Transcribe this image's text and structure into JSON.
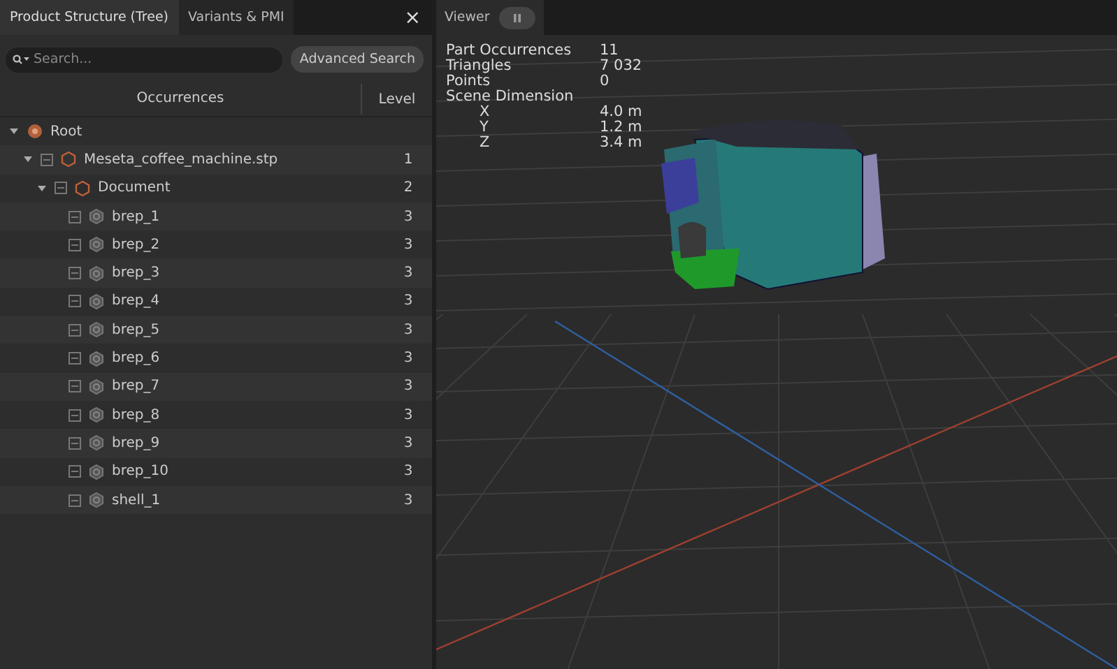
{
  "left_panel": {
    "tabs": [
      {
        "label": "Product Structure (Tree)",
        "selected": true
      },
      {
        "label": "Variants & PMI",
        "selected": false
      }
    ],
    "close": "×",
    "search": {
      "placeholder": "Search..."
    },
    "advanced_search": "Advanced Search",
    "columns": [
      "Occurrences",
      "Level"
    ],
    "tree": [
      {
        "name": "Root",
        "kind": "root",
        "expanded": true,
        "children": [
          {
            "name": "Meseta_coffee_machine.stp",
            "level": "1",
            "kind": "assembly",
            "checked": true,
            "expanded": true,
            "children": [
              {
                "name": "Document",
                "level": "2",
                "kind": "assembly",
                "checked": true,
                "expanded": true,
                "children": [
                  {
                    "name": "brep_1",
                    "level": "3",
                    "kind": "part",
                    "checked": true
                  },
                  {
                    "name": "brep_2",
                    "level": "3",
                    "kind": "part",
                    "checked": true
                  },
                  {
                    "name": "brep_3",
                    "level": "3",
                    "kind": "part",
                    "checked": true
                  },
                  {
                    "name": "brep_4",
                    "level": "3",
                    "kind": "part",
                    "checked": true
                  },
                  {
                    "name": "brep_5",
                    "level": "3",
                    "kind": "part",
                    "checked": true
                  },
                  {
                    "name": "brep_6",
                    "level": "3",
                    "kind": "part",
                    "checked": true
                  },
                  {
                    "name": "brep_7",
                    "level": "3",
                    "kind": "part",
                    "checked": true
                  },
                  {
                    "name": "brep_8",
                    "level": "3",
                    "kind": "part",
                    "checked": true
                  },
                  {
                    "name": "brep_9",
                    "level": "3",
                    "kind": "part",
                    "checked": true
                  },
                  {
                    "name": "brep_10",
                    "level": "3",
                    "kind": "part",
                    "checked": true
                  },
                  {
                    "name": "shell_1",
                    "level": "3",
                    "kind": "part",
                    "checked": true
                  }
                ]
              }
            ]
          }
        ]
      }
    ]
  },
  "viewer": {
    "tab": "Viewer",
    "stats": [
      {
        "label": "Part Occurrences",
        "value": "11"
      },
      {
        "label": "Triangles",
        "value": "7 032"
      },
      {
        "label": "Points",
        "value": "0"
      },
      {
        "label": "Scene Dimension",
        "children": [
          {
            "label": "X",
            "value": "4.0 m"
          },
          {
            "label": "Y",
            "value": "1.2 m"
          },
          {
            "label": "Z",
            "value": "3.4 m"
          }
        ]
      }
    ]
  }
}
